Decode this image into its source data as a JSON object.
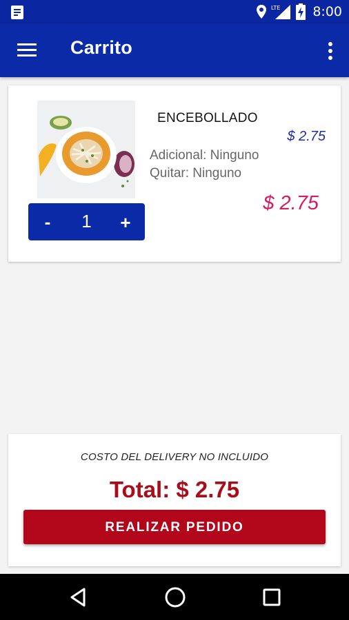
{
  "status_bar": {
    "time": "8:00",
    "network": "LTE",
    "icons": [
      "notes-icon",
      "location-pin-icon",
      "signal-icon",
      "battery-charging-icon"
    ]
  },
  "app_bar": {
    "title": "Carrito",
    "menu_icon": "hamburger-menu-icon",
    "more_icon": "more-vert-icon"
  },
  "cart": {
    "items": [
      {
        "name": "ENCEBOLLADO",
        "unit_price": "$ 2.75",
        "adicional": "Adicional: Ninguno",
        "quitar": "Quitar: Ninguno",
        "line_total": "$ 2.75",
        "quantity": "1",
        "minus_label": "-",
        "plus_label": "+"
      }
    ]
  },
  "summary": {
    "delivery_note": "COSTO DEL DELIVERY NO INCLUIDO",
    "total": "Total: $ 2.75",
    "order_button": "REALIZAR PEDIDO"
  },
  "colors": {
    "primary": "#0a2aa8",
    "status_bar": "#0a26a0",
    "accent_price": "#d81b60",
    "unit_price": "#1c2fa0",
    "total": "#a90d18",
    "order_button": "#b2061a",
    "background": "#f3f3f3"
  },
  "nav_bar": {
    "icons": [
      "back-icon",
      "home-icon",
      "recent-apps-icon"
    ]
  }
}
